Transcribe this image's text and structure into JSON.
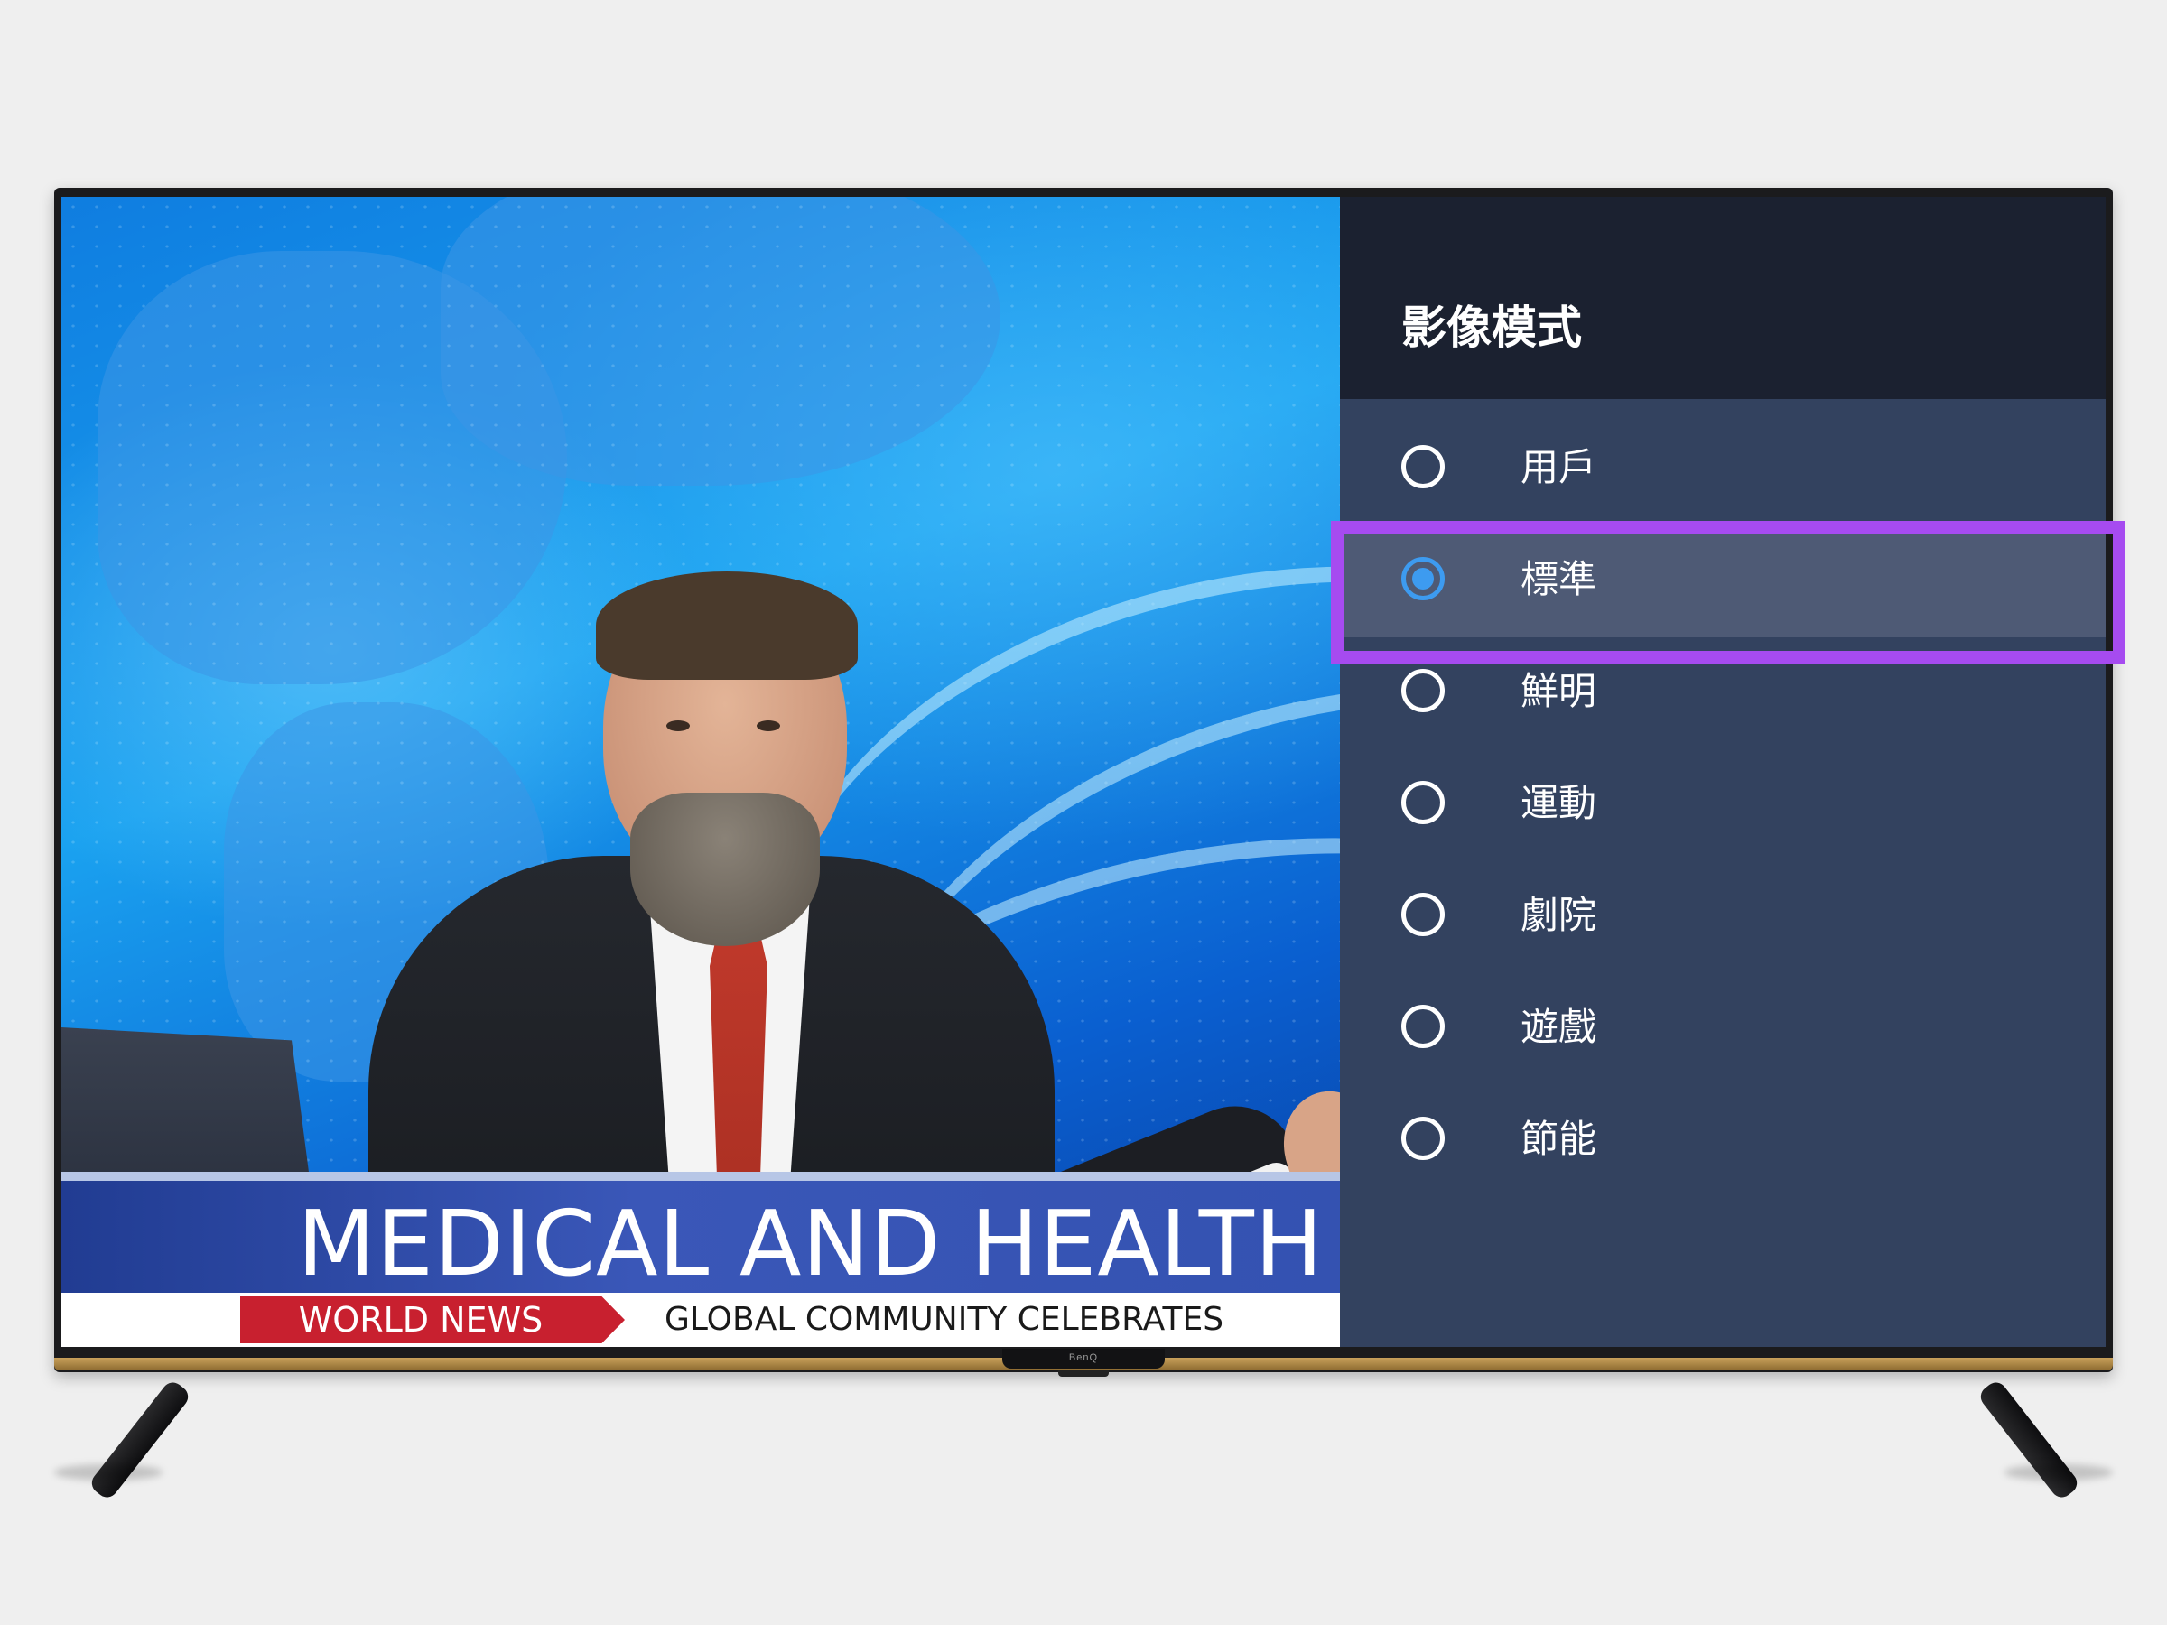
{
  "video": {
    "headline": "MEDICAL AND HEALTH",
    "tag": "WORLD NEWS",
    "ticker": "GLOBAL COMMUNITY CELEBRATES"
  },
  "tv": {
    "brand": "BenQ"
  },
  "menu": {
    "title": "影像模式",
    "selected_index": 1,
    "items": [
      {
        "label": "用戶",
        "checked": false
      },
      {
        "label": "標準",
        "checked": true
      },
      {
        "label": "鮮明",
        "checked": false
      },
      {
        "label": "運動",
        "checked": false
      },
      {
        "label": "劇院",
        "checked": false
      },
      {
        "label": "遊戲",
        "checked": false
      },
      {
        "label": "節能",
        "checked": false
      }
    ]
  },
  "colors": {
    "menu_bg": "#33425f",
    "menu_header_bg": "#1b2130",
    "selected_row_bg": "#4e5a75",
    "radio_checked": "#3d9bf0",
    "focus_ring": "#a64bf0",
    "news_tag_red": "#c8202f"
  },
  "icons": {
    "radio_unchecked": "radio-unchecked-icon",
    "radio_checked": "radio-checked-icon"
  }
}
